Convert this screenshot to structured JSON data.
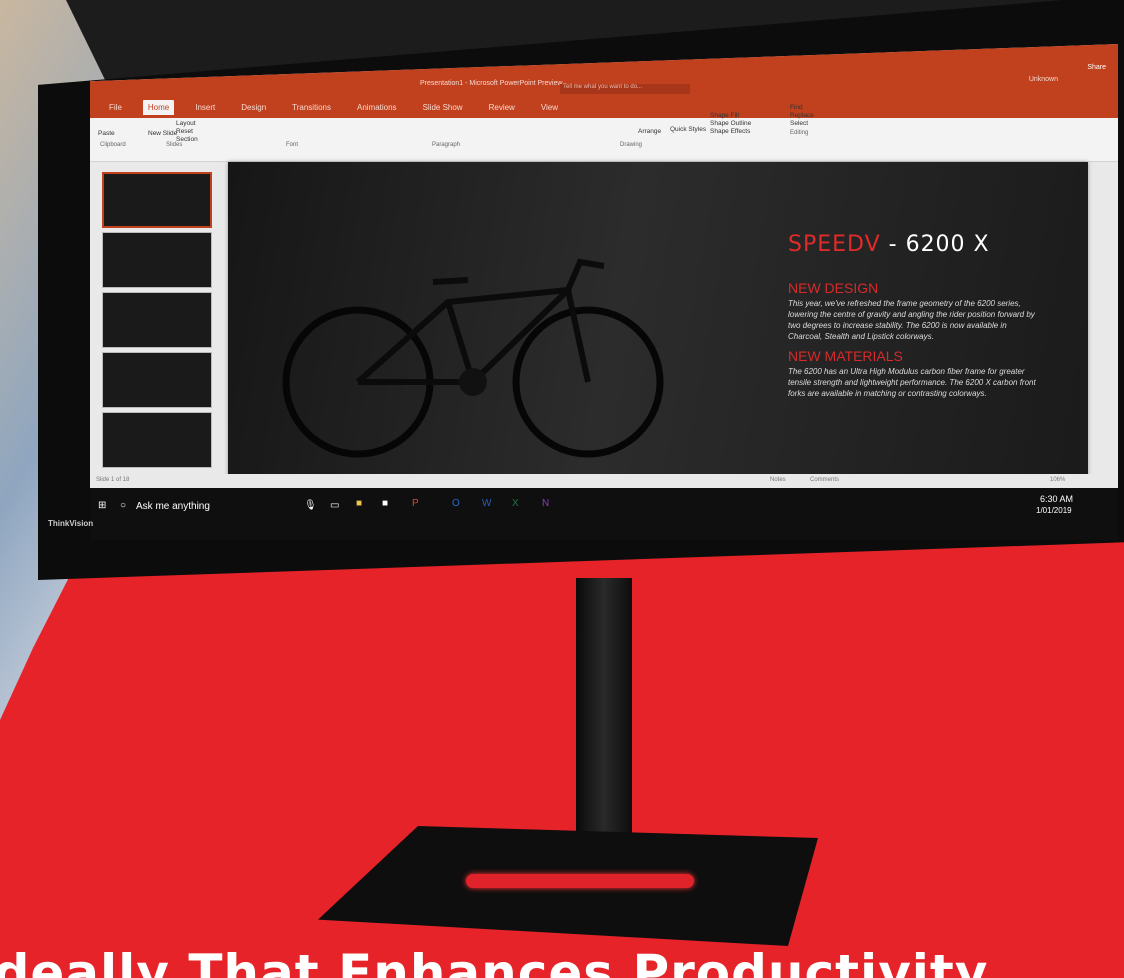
{
  "headline": "Ideally That Enhances Productivity",
  "monitor_brand": "ThinkVision",
  "app": {
    "title": "Presentation1 - Microsoft PowerPoint Preview",
    "tell_me": "Tell me what you want to do...",
    "user": "Unknown",
    "share": "Share",
    "tabs": [
      "File",
      "Home",
      "Insert",
      "Design",
      "Transitions",
      "Animations",
      "Slide Show",
      "Review",
      "View"
    ],
    "ribbon": {
      "paste": "Paste",
      "clipboard": "Clipboard",
      "new_slide": "New Slide",
      "layout": "Layout",
      "reset": "Reset",
      "section": "Section",
      "slides": "Slides",
      "font": "Font",
      "paragraph": "Paragraph",
      "drawing": "Drawing",
      "arrange": "Arrange",
      "quick_styles": "Quick Styles",
      "shape_fill": "Shape Fill",
      "shape_outline": "Shape Outline",
      "shape_effects": "Shape Effects",
      "find": "Find",
      "replace": "Replace",
      "select": "Select",
      "editing": "Editing"
    },
    "slide": {
      "title_red": "SPEEDV",
      "title_rest": " - 6200 X",
      "h1": "NEW DESIGN",
      "p1": "This year, we've refreshed the frame geometry of the 6200 series, lowering the centre of gravity and angling the rider position forward by two degrees to increase stability. The 6200 is now available in Charcoal, Stealth and Lipstick colorways.",
      "h2": "NEW MATERIALS",
      "p2": "The 6200 has an Ultra High Modulus carbon fiber frame for greater tensile strength and lightweight performance. The 6200 X carbon front forks are available in matching or contrasting colorways."
    },
    "status": {
      "slide_count": "Slide 1 of 18",
      "notes": "Notes",
      "comments": "Comments",
      "zoom": "106%"
    },
    "taskbar": {
      "search": "Ask me anything",
      "time": "6:30 AM",
      "date": "1/01/2019"
    }
  },
  "colors": {
    "accent": "#c1411f",
    "background": "#e62329"
  }
}
